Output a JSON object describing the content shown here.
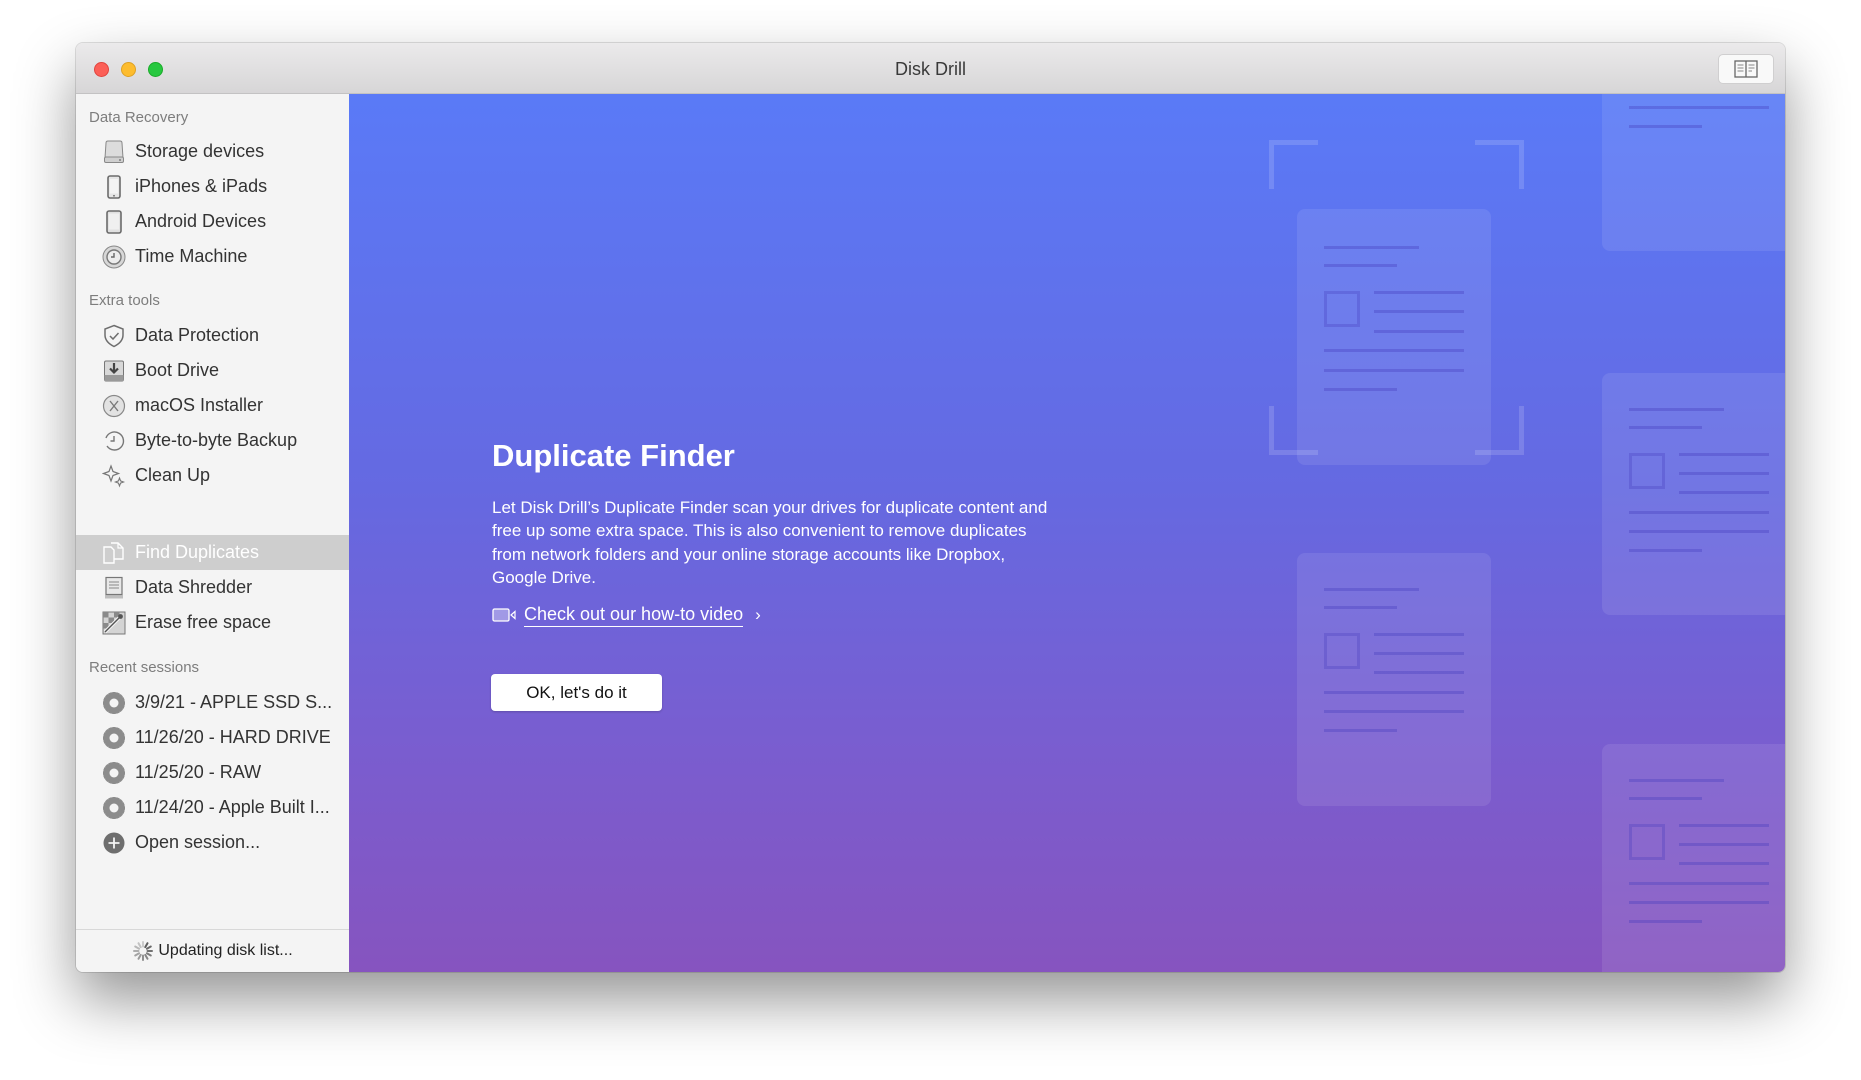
{
  "window": {
    "title": "Disk Drill",
    "controls": [
      "close",
      "minimize",
      "zoom"
    ],
    "toolbar_icon": "sidebar-toggle-icon"
  },
  "sidebar": {
    "sections": [
      {
        "header": "Data Recovery",
        "items": [
          {
            "label": "Storage devices",
            "icon": "hard-drive-icon"
          },
          {
            "label": "iPhones & iPads",
            "icon": "iphone-icon"
          },
          {
            "label": "Android Devices",
            "icon": "android-device-icon"
          },
          {
            "label": "Time Machine",
            "icon": "time-machine-icon"
          }
        ]
      },
      {
        "header": "Extra tools",
        "items": [
          {
            "label": "Data Protection",
            "icon": "shield-check-icon"
          },
          {
            "label": "Boot Drive",
            "icon": "boot-drive-icon"
          },
          {
            "label": "macOS Installer",
            "icon": "macos-installer-icon"
          },
          {
            "label": "Byte-to-byte Backup",
            "icon": "backup-clock-icon"
          },
          {
            "label": "Clean Up",
            "icon": "sparkles-icon"
          },
          {
            "label": "Find Duplicates",
            "icon": "duplicate-files-icon",
            "selected": true
          },
          {
            "label": "Data Shredder",
            "icon": "shredder-icon"
          },
          {
            "label": "Erase free space",
            "icon": "erase-space-icon"
          }
        ]
      },
      {
        "header": "Recent sessions",
        "items": [
          {
            "label": "3/9/21 - APPLE SSD S...",
            "icon": "gear-icon"
          },
          {
            "label": "11/26/20 - HARD DRIVE",
            "icon": "gear-icon"
          },
          {
            "label": "11/25/20 - RAW",
            "icon": "gear-icon"
          },
          {
            "label": "11/24/20 - Apple Built I...",
            "icon": "gear-icon"
          },
          {
            "label": "Open session...",
            "icon": "plus-circle-icon"
          }
        ]
      }
    ],
    "footer": {
      "status": "Updating disk list...",
      "icon": "spinner-icon"
    }
  },
  "main": {
    "title": "Duplicate Finder",
    "description": "Let Disk Drill’s Duplicate Finder scan your drives for duplicate content and free up some extra space. This is also convenient to remove duplicates from network folders and your online storage accounts like Dropbox, Google Drive.",
    "video_link": {
      "label": "Check out our how-to video",
      "icon": "video-camera-icon",
      "chevron": "›"
    },
    "primary_button": "OK, let's do it"
  },
  "colors": {
    "gradient_top": "#5a7af7",
    "gradient_bottom": "#8654bf",
    "sidebar_bg": "#f4f4f4",
    "selected_row": "#cecece"
  }
}
